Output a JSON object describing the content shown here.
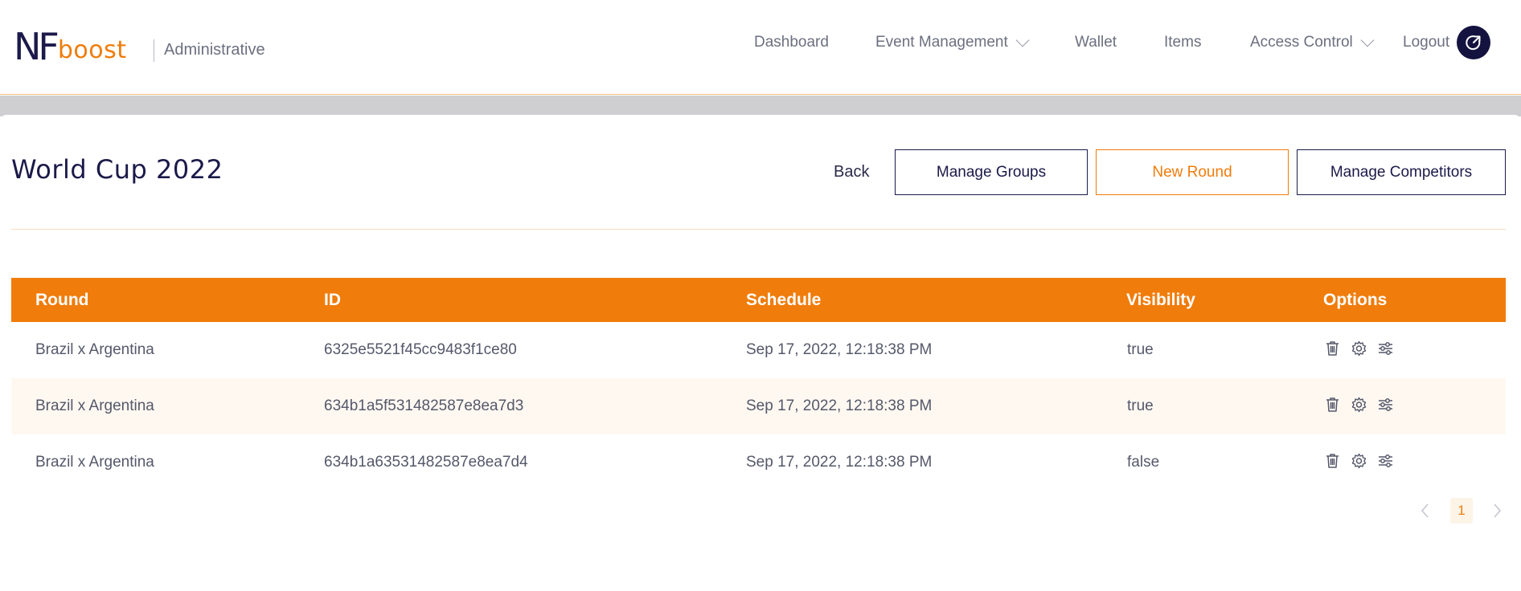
{
  "brand": {
    "logo_nf": "NF",
    "logo_boost": "boost",
    "subtitle": "Administrative",
    "colors": {
      "navy": "#1b1a4a",
      "orange": "#f07c0b"
    }
  },
  "nav": {
    "dashboard": "Dashboard",
    "event_management": "Event Management",
    "wallet": "Wallet",
    "items": "Items",
    "access_control": "Access Control",
    "logout": "Logout",
    "logout_icon": "logout-arrow-icon"
  },
  "page": {
    "title": "World Cup 2022",
    "back": "Back",
    "manage_groups": "Manage Groups",
    "new_round": "New Round",
    "manage_competitors": "Manage Competitors"
  },
  "table": {
    "headers": {
      "round": "Round",
      "id": "ID",
      "schedule": "Schedule",
      "visibility": "Visibility",
      "options": "Options"
    },
    "rows": [
      {
        "round": "Brazil x Argentina",
        "id": "6325e5521f45cc9483f1ce80",
        "schedule": "Sep 17, 2022, 12:18:38 PM",
        "visibility": "true"
      },
      {
        "round": "Brazil x Argentina",
        "id": "634b1a5f531482587e8ea7d3",
        "schedule": "Sep 17, 2022, 12:18:38 PM",
        "visibility": "true"
      },
      {
        "round": "Brazil x Argentina",
        "id": "634b1a63531482587e8ea7d4",
        "schedule": "Sep 17, 2022, 12:18:38 PM",
        "visibility": "false"
      }
    ],
    "option_icons": [
      "trash-icon",
      "gear-icon",
      "sliders-icon"
    ]
  },
  "pagination": {
    "current_page": "1"
  }
}
